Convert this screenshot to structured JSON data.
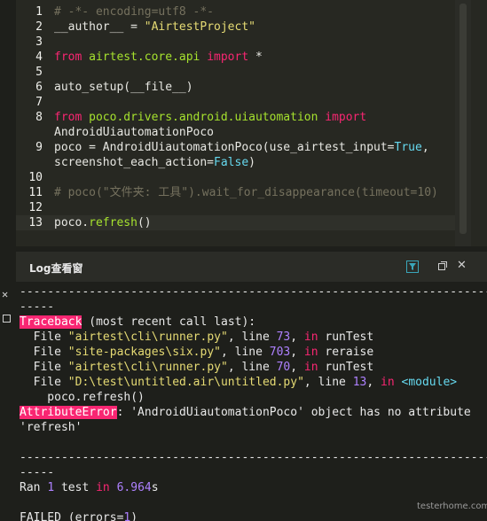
{
  "editor": {
    "lines": [
      {
        "num": "1",
        "tokens": [
          {
            "t": "# -*- encoding=utf8 -*-",
            "c": "comment"
          }
        ]
      },
      {
        "num": "2",
        "tokens": [
          {
            "t": "__author__ = ",
            "c": "plain"
          },
          {
            "t": "\"AirtestProject\"",
            "c": "str"
          }
        ]
      },
      {
        "num": "3",
        "tokens": []
      },
      {
        "num": "4",
        "tokens": [
          {
            "t": "from ",
            "c": "kw"
          },
          {
            "t": "airtest.core.api ",
            "c": "mod"
          },
          {
            "t": "import ",
            "c": "kw"
          },
          {
            "t": "*",
            "c": "plain"
          }
        ]
      },
      {
        "num": "5",
        "tokens": []
      },
      {
        "num": "6",
        "tokens": [
          {
            "t": "auto_setup(__file__)",
            "c": "plain"
          }
        ]
      },
      {
        "num": "7",
        "tokens": []
      },
      {
        "num": "8",
        "tokens": [
          {
            "t": "from ",
            "c": "kw"
          },
          {
            "t": "poco.drivers.android.uiautomation ",
            "c": "mod"
          },
          {
            "t": "import",
            "c": "kw"
          }
        ]
      },
      {
        "num": "",
        "tokens": [
          {
            "t": "AndroidUiautomationPoco",
            "c": "plain"
          }
        ]
      },
      {
        "num": "9",
        "tokens": [
          {
            "t": "poco = AndroidUiautomationPoco(use_airtest_input=",
            "c": "plain"
          },
          {
            "t": "True",
            "c": "const"
          },
          {
            "t": ",",
            "c": "plain"
          }
        ]
      },
      {
        "num": "",
        "tokens": [
          {
            "t": "screenshot_each_action=",
            "c": "plain"
          },
          {
            "t": "False",
            "c": "const"
          },
          {
            "t": ")",
            "c": "plain"
          }
        ]
      },
      {
        "num": "10",
        "tokens": []
      },
      {
        "num": "11",
        "tokens": [
          {
            "t": "# poco(\"文件夹: 工具\").wait_for_disappearance(timeout=10)",
            "c": "comment"
          }
        ]
      },
      {
        "num": "12",
        "tokens": []
      },
      {
        "num": "13",
        "tokens": [
          {
            "t": "poco.",
            "c": "plain"
          },
          {
            "t": "refresh",
            "c": "fn"
          },
          {
            "t": "()",
            "c": "plain"
          }
        ],
        "current": true
      }
    ]
  },
  "log_panel": {
    "title": "Log查看窗",
    "lines": [
      [
        {
          "t": "----------------------------------------------------------------------",
          "c": ""
        }
      ],
      [
        {
          "t": "-----",
          "c": ""
        }
      ],
      [
        {
          "t": "Traceback",
          "c": "hl"
        },
        {
          "t": " (most recent call last):",
          "c": ""
        }
      ],
      [
        {
          "t": "  File ",
          "c": ""
        },
        {
          "t": "\"airtest\\cli\\runner.py\"",
          "c": "str"
        },
        {
          "t": ", line ",
          "c": ""
        },
        {
          "t": "73",
          "c": "num"
        },
        {
          "t": ", ",
          "c": ""
        },
        {
          "t": "in",
          "c": "kw"
        },
        {
          "t": " runTest",
          "c": ""
        }
      ],
      [
        {
          "t": "  File ",
          "c": ""
        },
        {
          "t": "\"site-packages\\six.py\"",
          "c": "str"
        },
        {
          "t": ", line ",
          "c": ""
        },
        {
          "t": "703",
          "c": "num"
        },
        {
          "t": ", ",
          "c": ""
        },
        {
          "t": "in",
          "c": "kw"
        },
        {
          "t": " reraise",
          "c": ""
        }
      ],
      [
        {
          "t": "  File ",
          "c": ""
        },
        {
          "t": "\"airtest\\cli\\runner.py\"",
          "c": "str"
        },
        {
          "t": ", line ",
          "c": ""
        },
        {
          "t": "70",
          "c": "num"
        },
        {
          "t": ", ",
          "c": ""
        },
        {
          "t": "in",
          "c": "kw"
        },
        {
          "t": " runTest",
          "c": ""
        }
      ],
      [
        {
          "t": "  File ",
          "c": ""
        },
        {
          "t": "\"D:\\test\\untitled.air\\untitled.py\"",
          "c": "str"
        },
        {
          "t": ", line ",
          "c": ""
        },
        {
          "t": "13",
          "c": "num"
        },
        {
          "t": ", ",
          "c": ""
        },
        {
          "t": "in",
          "c": "kw"
        },
        {
          "t": " ",
          "c": ""
        },
        {
          "t": "<module>",
          "c": "blue"
        }
      ],
      [
        {
          "t": "    poco.refresh()",
          "c": ""
        }
      ],
      [
        {
          "t": "AttributeError",
          "c": "hl"
        },
        {
          "t": ": 'AndroidUiautomationPoco' object has no attribute",
          "c": ""
        }
      ],
      [
        {
          "t": "'refresh'",
          "c": ""
        }
      ],
      [],
      [
        {
          "t": "----------------------------------------------------------------------",
          "c": ""
        }
      ],
      [
        {
          "t": "-----",
          "c": ""
        }
      ],
      [
        {
          "t": "Ran ",
          "c": ""
        },
        {
          "t": "1",
          "c": "num"
        },
        {
          "t": " test ",
          "c": ""
        },
        {
          "t": "in",
          "c": "kw"
        },
        {
          "t": " ",
          "c": ""
        },
        {
          "t": "6.964",
          "c": "num"
        },
        {
          "t": "s",
          "c": ""
        }
      ],
      [],
      [
        {
          "t": "FAILED (errors=",
          "c": ""
        },
        {
          "t": "1",
          "c": "num"
        },
        {
          "t": ")",
          "c": ""
        }
      ]
    ]
  },
  "watermark": "testerhome.com"
}
